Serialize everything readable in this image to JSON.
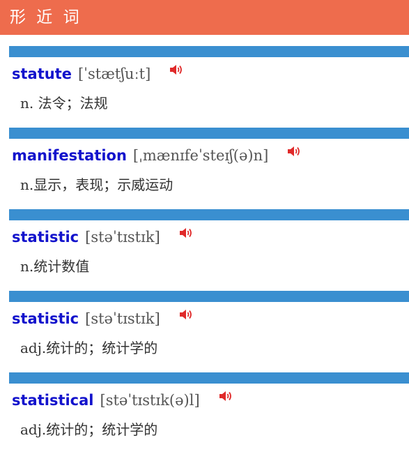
{
  "header": {
    "title": "形 近 词"
  },
  "entries": [
    {
      "word": "statute",
      "phonetic": "[ˈstætʃuːt]",
      "definition": "n. 法令；法规",
      "icon": "speaker-icon"
    },
    {
      "word": "manifestation",
      "phonetic": "[ˌmænɪfeˈsteɪʃ(ə)n]",
      "definition": "n.显示，表现；示威运动",
      "icon": "speaker-icon"
    },
    {
      "word": "statistic",
      "phonetic": "[stəˈtɪstɪk]",
      "definition": "n.统计数值",
      "icon": "speaker-icon"
    },
    {
      "word": "statistic",
      "phonetic": "[stəˈtɪstɪk]",
      "definition": "adj.统计的；统计学的",
      "icon": "speaker-icon"
    },
    {
      "word": "statistical",
      "phonetic": "[stəˈtɪstɪk(ə)l]",
      "definition": "adj.统计的；统计学的",
      "icon": "speaker-icon"
    }
  ],
  "colors": {
    "header_bg": "#ee6c4d",
    "bar": "#3a8fd0",
    "word": "#1212cc",
    "speaker": "#e02a2a"
  }
}
